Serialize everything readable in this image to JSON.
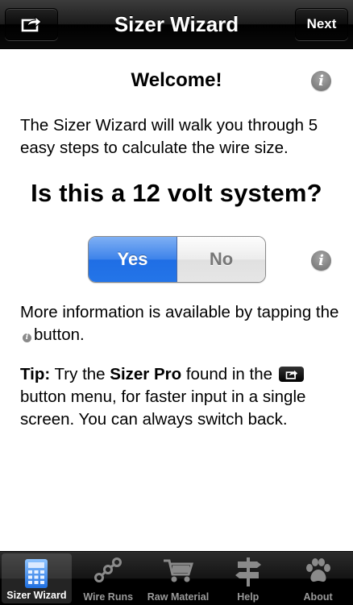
{
  "navbar": {
    "title": "Sizer Wizard",
    "share_icon": "share-box-icon",
    "next_label": "Next"
  },
  "content": {
    "welcome": "Welcome!",
    "intro": "The Sizer Wizard will walk you through 5 easy steps to calculate the wire size.",
    "question": "Is this a 12 volt system?",
    "segment": {
      "yes_label": "Yes",
      "no_label": "No",
      "selected": "Yes"
    },
    "more_info_before": "More information is available by tapping the",
    "more_info_after": "button.",
    "tip": {
      "label": "Tip:",
      "part1": "Try the",
      "product": "Sizer Pro",
      "part2": "found in the",
      "part3": "button menu, for faster input in a single screen. You can always switch back."
    }
  },
  "tabbar": {
    "items": [
      {
        "label": "Sizer Wizard",
        "icon": "calculator-icon",
        "active": true
      },
      {
        "label": "Wire Runs",
        "icon": "wire-runs-icon",
        "active": false
      },
      {
        "label": "Raw Material",
        "icon": "cart-icon",
        "active": false
      },
      {
        "label": "Help",
        "icon": "signpost-icon",
        "active": false
      },
      {
        "label": "About",
        "icon": "paw-icon",
        "active": false
      }
    ]
  },
  "colors": {
    "accent_blue": "#2a78e8",
    "navbar": "#1c1c1c"
  }
}
